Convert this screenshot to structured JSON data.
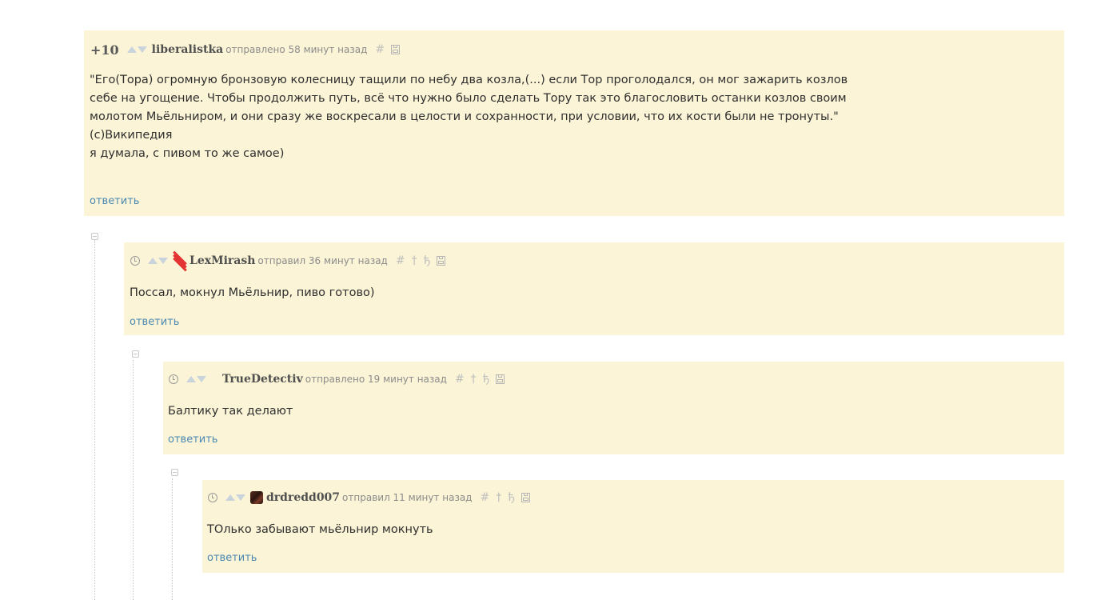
{
  "colors": {
    "panel_bg": "#fbf4d6",
    "link": "#4a89b3",
    "avatar_x": "#e33333"
  },
  "comments": [
    {
      "rating": "+10",
      "username": "liberalistka",
      "meta": "отправлено 58 минут назад",
      "lines": [
        "\"Его(Тора) огромную бронзовую колесницу тащили по небу два козла,(...) если Тор проголодался, он мог зажарить козлов",
        "себе на угощение. Чтобы продолжить путь, всё что нужно было сделать Тору так это благословить останки козлов своим",
        "молотом Мьёльниром, и они сразу же воскресали в целости и сохранности, при условии, что их кости были не тронуты.\"",
        "(с)Википедия",
        "я думала, с пивом то же самое)"
      ],
      "reply": "ответить",
      "tools": [
        "#"
      ]
    },
    {
      "username": "LexMirash",
      "meta": "отправил 36 минут назад",
      "lines": [
        "Поссал, мокнул Мьёльнир, пиво готово)"
      ],
      "reply": "ответить",
      "tools": [
        "#",
        "†",
        "ђ"
      ]
    },
    {
      "username": "TrueDetectiv",
      "meta": "отправлено 19 минут назад",
      "lines": [
        "Балтику так делают"
      ],
      "reply": "ответить",
      "tools": [
        "#",
        "†",
        "ђ"
      ]
    },
    {
      "username": "drdredd007",
      "meta": "отправил 11 минут назад",
      "lines": [
        "ТОлько забывают мьёльнир мокнуть"
      ],
      "reply": "ответить",
      "tools": [
        "#",
        "†",
        "ђ"
      ]
    }
  ]
}
